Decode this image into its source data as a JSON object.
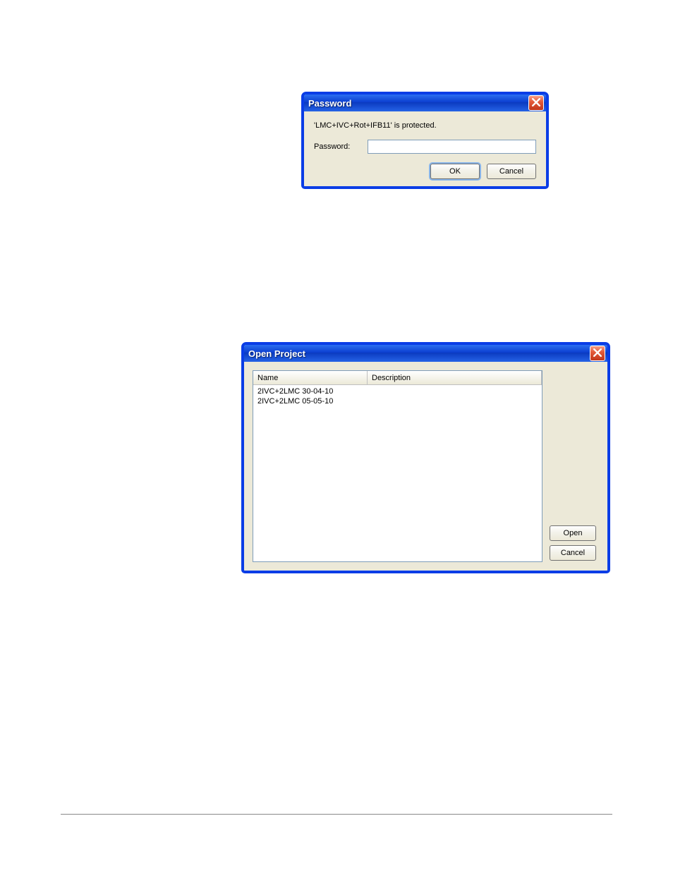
{
  "password_dialog": {
    "title": "Password",
    "message": "'LMC+IVC+Rot+IFB11' is protected.",
    "password_label": "Password:",
    "password_value": "",
    "ok_label": "OK",
    "cancel_label": "Cancel"
  },
  "open_project_dialog": {
    "title": "Open Project",
    "columns": {
      "name": "Name",
      "description": "Description"
    },
    "rows": [
      {
        "name": "2IVC+2LMC 30-04-10",
        "description": ""
      },
      {
        "name": "2IVC+2LMC 05-05-10",
        "description": ""
      }
    ],
    "open_label": "Open",
    "cancel_label": "Cancel"
  }
}
